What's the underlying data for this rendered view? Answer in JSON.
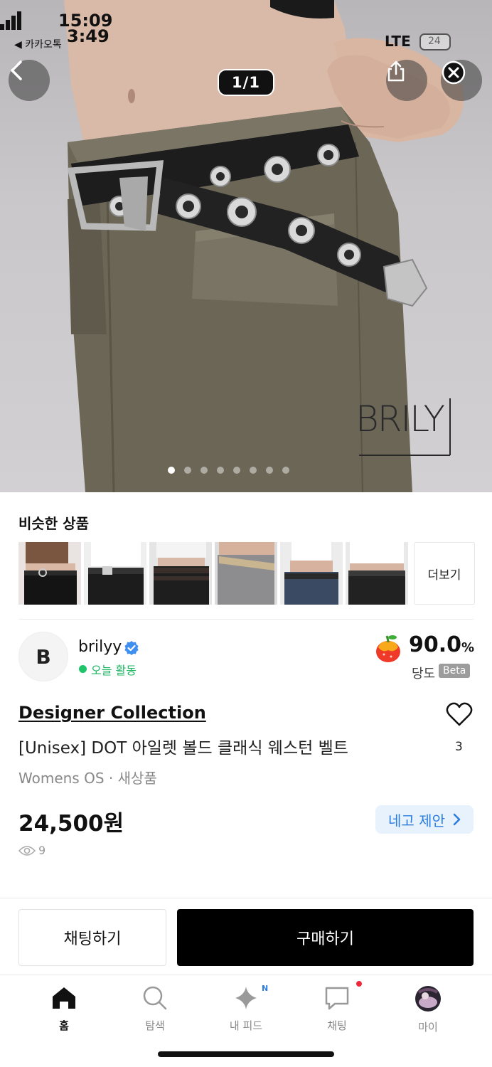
{
  "status_bar": {
    "time_top": "15:09",
    "time_bottom": "3:49",
    "back_app": "◀ 카카오톡",
    "network": "LTE",
    "battery": "24"
  },
  "viewer": {
    "counter": "1/1",
    "back_icon": "chevron-left-icon",
    "share_icon": "share-icon",
    "close_icon": "close-circle-icon",
    "page_dots_total": 8,
    "page_dots_active": 1,
    "watermark": "BRILY"
  },
  "similar": {
    "title": "비슷한 상품",
    "thumbnails": [
      "similar-1",
      "similar-2",
      "similar-3",
      "similar-4",
      "similar-5",
      "similar-6"
    ],
    "more_label": "더보기"
  },
  "seller": {
    "avatar_letter": "B",
    "name": "brilyy",
    "status": "오늘 활동",
    "sweetness_score": "90.0",
    "sweetness_unit": "%",
    "sweetness_label": "당도",
    "beta_label": "Beta"
  },
  "product": {
    "collection": "Designer Collection",
    "name": "[Unisex] DOT 아일렛 볼드 클래식 웨스턴 벨트",
    "meta": "Womens OS · 새상품",
    "price": "24,500원",
    "like_count": "3",
    "views": "9",
    "offer_label": "네고 제안"
  },
  "actions": {
    "chat_label": "채팅하기",
    "buy_label": "구매하기"
  },
  "tabs": [
    {
      "label": "홈",
      "icon": "home-icon",
      "active": true
    },
    {
      "label": "탐색",
      "icon": "search-icon",
      "active": false
    },
    {
      "label": "내 피드",
      "icon": "sparkle-icon",
      "active": false,
      "badge": "N"
    },
    {
      "label": "채팅",
      "icon": "chat-icon",
      "active": false
    },
    {
      "label": "마이",
      "icon": "profile-avatar-icon",
      "active": false
    }
  ],
  "colors": {
    "accent_blue": "#2b7de0",
    "active_green": "#1fb662",
    "buy_black": "#000000",
    "badge_red": "#f0283c"
  }
}
